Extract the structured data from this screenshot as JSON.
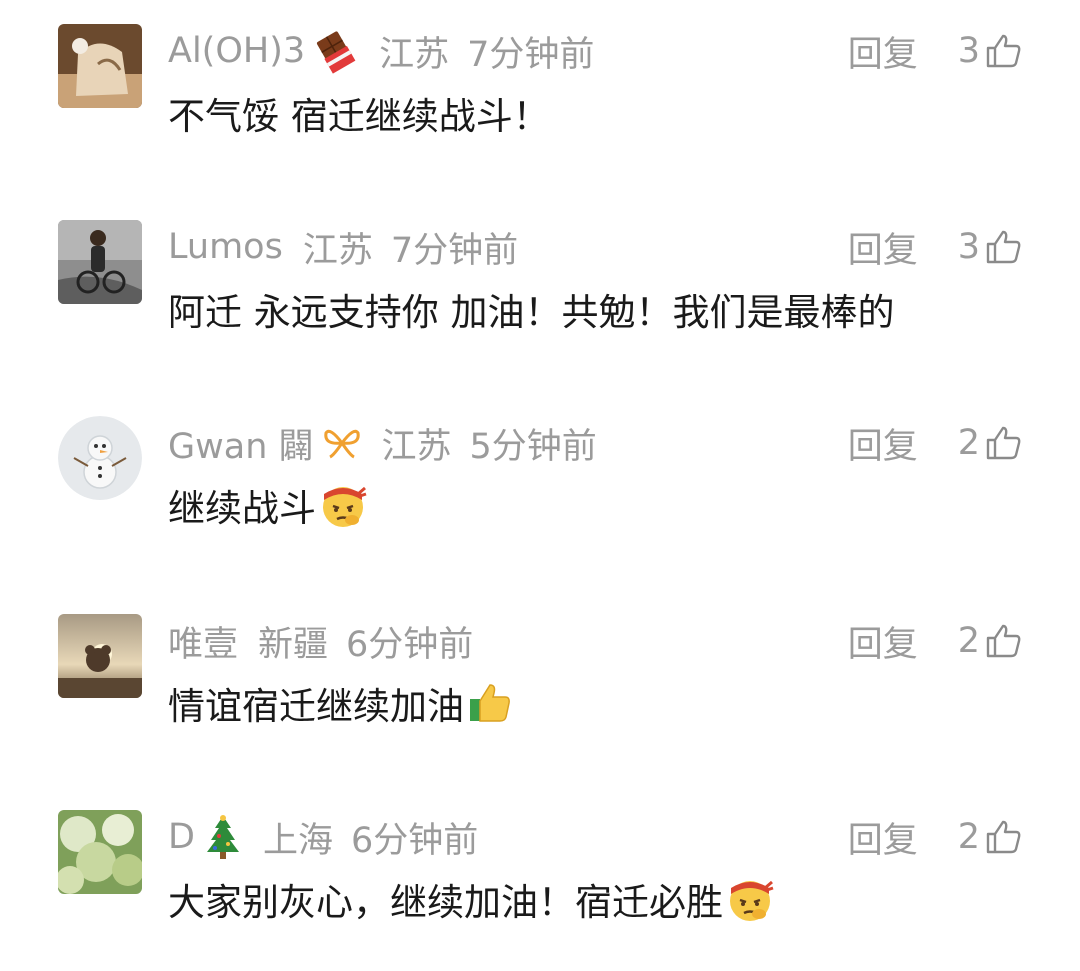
{
  "comments": [
    {
      "nickname": "Al(OH)3",
      "badge_icon": "chocolate-bar-icon",
      "region": "江苏",
      "time": "7分钟前",
      "reply_label": "回复",
      "likes": "3",
      "text": "不气馁 宿迁继续战斗！",
      "trailing_emoji": ""
    },
    {
      "nickname": "Lumos",
      "badge_icon": "",
      "region": "江苏",
      "time": "7分钟前",
      "reply_label": "回复",
      "likes": "3",
      "text": "阿迁 永远支持你 加油！共勉！我们是最棒的",
      "trailing_emoji": ""
    },
    {
      "nickname": "Gwan 闢",
      "badge_icon": "ribbon-bow-icon",
      "region": "江苏",
      "time": "5分钟前",
      "reply_label": "回复",
      "likes": "2",
      "text": "继续战斗",
      "trailing_emoji": "determined-face-emoji"
    },
    {
      "nickname": "唯壹",
      "badge_icon": "",
      "region": "新疆",
      "time": "6分钟前",
      "reply_label": "回复",
      "likes": "2",
      "text": "情谊宿迁继续加油",
      "trailing_emoji": "thumbs-up-emoji"
    },
    {
      "nickname": "D",
      "badge_icon": "christmas-tree-icon",
      "region": "上海",
      "time": "6分钟前",
      "reply_label": "回复",
      "likes": "2",
      "text": "大家别灰心，继续加油！宿迁必胜",
      "trailing_emoji": "determined-face-emoji"
    }
  ],
  "colors": {
    "meta_text": "#9b9b9b",
    "body_text": "#1a1a1a",
    "background": "#ffffff"
  }
}
